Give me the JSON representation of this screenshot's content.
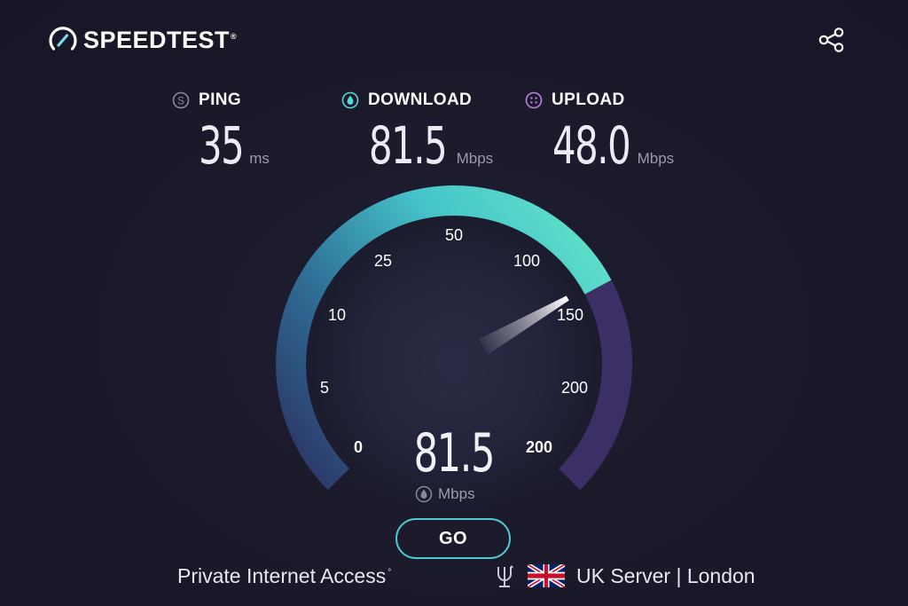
{
  "app": {
    "logo_text": "SPEEDTEST",
    "logo_mark": "®",
    "logo_icon": "speedometer-icon",
    "share_icon": "share-icon"
  },
  "stats": {
    "ping": {
      "label": "PING",
      "value": "35",
      "unit": "ms",
      "icon": "ping-icon",
      "icon_color": "#8a899c"
    },
    "download": {
      "label": "DOWNLOAD",
      "value": "81.5",
      "unit": "Mbps",
      "icon": "download-icon",
      "icon_color": "#56d5db"
    },
    "upload": {
      "label": "UPLOAD",
      "value": "48.0",
      "unit": "Mbps",
      "icon": "upload-icon",
      "icon_color": "#c07ee0"
    }
  },
  "gauge": {
    "scale_labels": [
      "0",
      "5",
      "10",
      "25",
      "50",
      "100",
      "150",
      "200",
      "200"
    ],
    "current_value": "81.5",
    "current_unit": "Mbps",
    "colors": {
      "start": "#2d3f6e",
      "mid": "#3aa6b9",
      "end": "#5fe0c8",
      "remaining": "#3b2f66"
    }
  },
  "go_button": {
    "label": "GO",
    "border_color": "#4fc7d1"
  },
  "footer": {
    "isp_name": "Private Internet Access",
    "isp_mark": "°",
    "server_icon": "server-icon",
    "flag_icon": "uk-flag-icon",
    "server_name": "UK Server | London"
  }
}
